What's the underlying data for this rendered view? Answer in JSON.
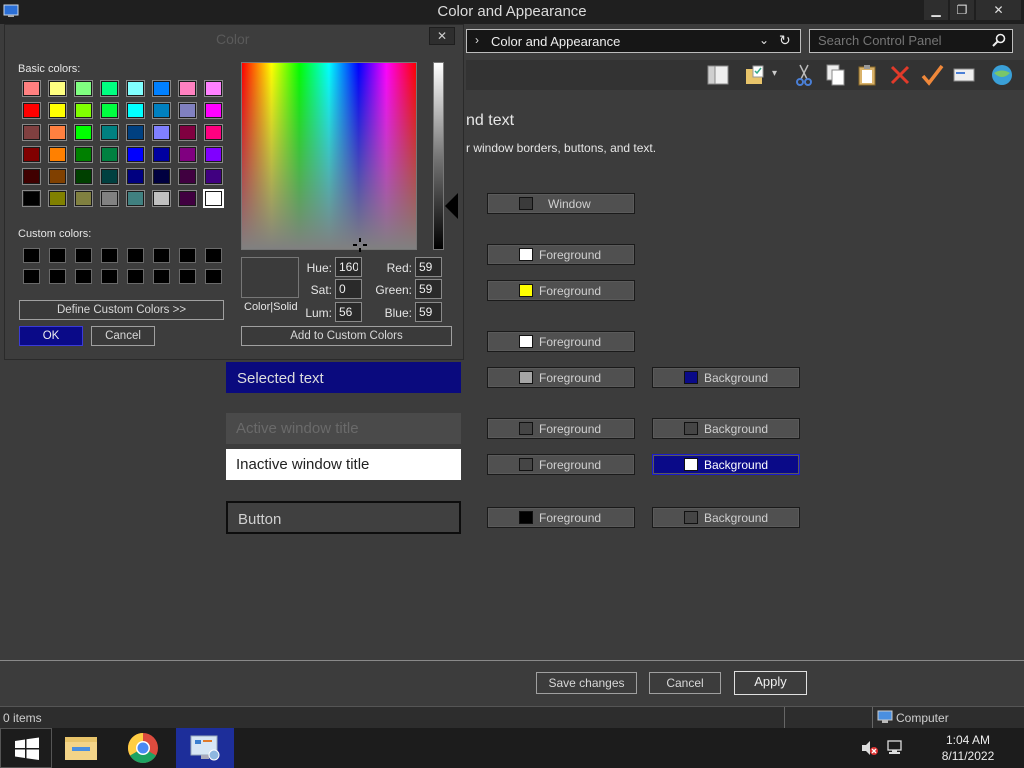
{
  "window": {
    "title": "Color and Appearance",
    "min_glyph": "▁",
    "max_glyph": "❐",
    "close_glyph": "✕"
  },
  "address": {
    "separator": "›",
    "crumb": "Color and Appearance",
    "dropdown_glyph": "⌄",
    "refresh_glyph": "↻"
  },
  "search": {
    "placeholder": "Search Control Panel"
  },
  "content": {
    "heading_fragment": "nd text",
    "subheading_fragment": "r window borders, buttons, and text."
  },
  "previews": {
    "selected": "Selected text",
    "active_title": "Active window title",
    "inactive_title": "Inactive window title",
    "button": "Button"
  },
  "color_buttons": [
    {
      "label": "Window",
      "swatch": "#3b3b3b"
    },
    {
      "label": "Foreground",
      "swatch": "#ffffff"
    },
    {
      "label": "Foreground",
      "swatch": "#ffff00"
    },
    {
      "label": "Foreground",
      "swatch": "#ffffff"
    },
    {
      "label": "Foreground",
      "swatch": "#a6a6a6"
    },
    {
      "label": "Background",
      "swatch": "#0a0a88"
    },
    {
      "label": "Foreground",
      "swatch": "#454545"
    },
    {
      "label": "Background",
      "swatch": "#454545"
    },
    {
      "label": "Foreground",
      "swatch": "#454545"
    },
    {
      "label": "Background",
      "swatch": "#ffffff"
    },
    {
      "label": "Foreground",
      "swatch": "#000000"
    },
    {
      "label": "Background",
      "swatch": "#454545"
    }
  ],
  "footer": {
    "save": "Save changes",
    "cancel": "Cancel",
    "apply": "Apply"
  },
  "status": {
    "items": "0 items",
    "location": "Computer"
  },
  "taskbar": {
    "time": "1:04 AM",
    "date": "8/11/2022"
  },
  "dialog": {
    "title": "Color",
    "close_glyph": "✕",
    "basic_label": "Basic colors:",
    "custom_label": "Custom colors:",
    "define_custom": "Define Custom Colors >>",
    "ok": "OK",
    "cancel": "Cancel",
    "solid_label": "Color|Solid",
    "add_custom": "Add to Custom Colors",
    "hue_label": "Hue:",
    "sat_label": "Sat:",
    "lum_label": "Lum:",
    "red_label": "Red:",
    "green_label": "Green:",
    "blue_label": "Blue:",
    "hue": "160",
    "sat": "0",
    "lum": "56",
    "red": "59",
    "green": "59",
    "blue": "59",
    "basic_colors": [
      "#ff8080",
      "#ffff80",
      "#80ff80",
      "#00ff80",
      "#80ffff",
      "#0080ff",
      "#ff80c0",
      "#ff80ff",
      "#ff0000",
      "#ffff00",
      "#80ff00",
      "#00ff40",
      "#00ffff",
      "#0080c0",
      "#8080c0",
      "#ff00ff",
      "#804040",
      "#ff8040",
      "#00ff00",
      "#008080",
      "#004080",
      "#8080ff",
      "#800040",
      "#ff0080",
      "#800000",
      "#ff8000",
      "#008000",
      "#008040",
      "#0000ff",
      "#0000a0",
      "#800080",
      "#8000ff",
      "#400000",
      "#804000",
      "#004000",
      "#004040",
      "#000080",
      "#000040",
      "#400040",
      "#400080",
      "#000000",
      "#808000",
      "#808040",
      "#808080",
      "#408080",
      "#c0c0c0",
      "#400040",
      "#ffffff"
    ],
    "selected_basic_index": 47
  }
}
